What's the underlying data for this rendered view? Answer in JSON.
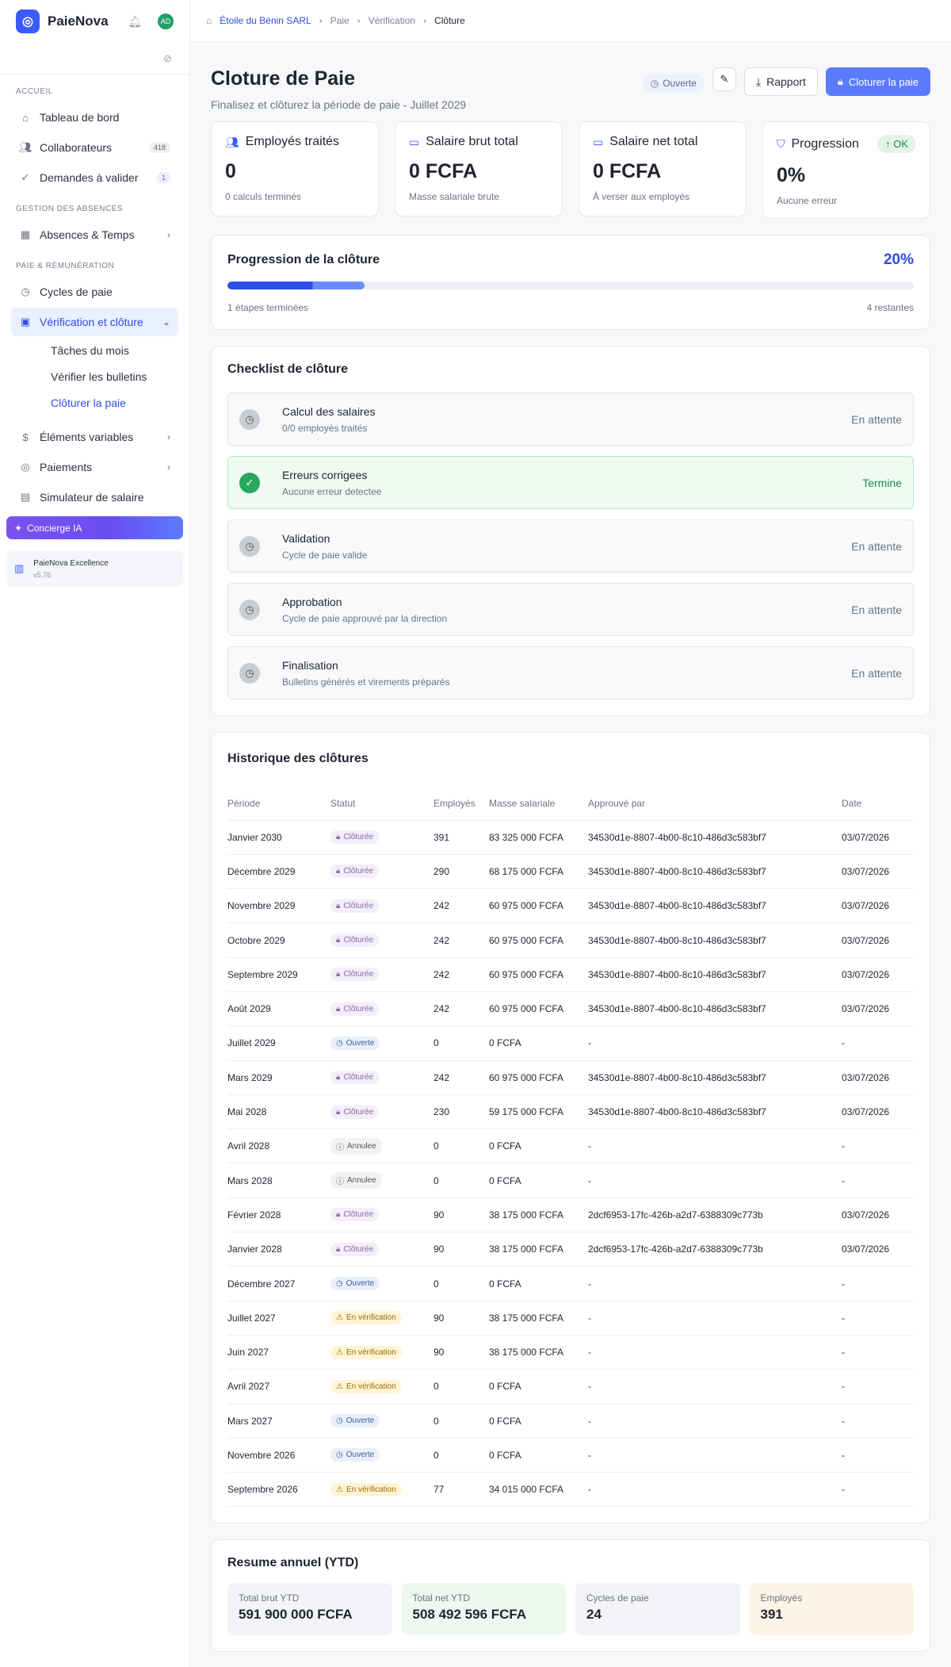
{
  "app": {
    "name": "PaieNova",
    "avatar": "AD"
  },
  "sidebar": {
    "sections": [
      "ACCUEIL",
      "GESTION DES ABSENCES",
      "PAIE & RÉMUNÉRATION"
    ],
    "home_items": [
      {
        "label": "Tableau de bord"
      },
      {
        "label": "Collaborateurs",
        "badge": "418"
      },
      {
        "label": "Demandes à valider",
        "badge": "1"
      }
    ],
    "absences": {
      "label": "Absences & Temps"
    },
    "pay_cycles": {
      "label": "Cycles de paie"
    },
    "verification": {
      "label": "Vérification et clôture"
    },
    "sub_items": [
      "Tâches du mois",
      "Vérifier les bulletins",
      "Clôturer la paie"
    ],
    "variable": {
      "label": "Éléments variables"
    },
    "payments": {
      "label": "Paiements"
    },
    "simulator": {
      "label": "Simulateur de salaire"
    },
    "concierge": {
      "label": "Concierge IA"
    },
    "footer": {
      "title": "PaieNova Excellence",
      "version": "v5.76"
    }
  },
  "breadcrumb": {
    "company": "Étoile du Bénin SARL",
    "items": [
      "Paie",
      "Vérification",
      "Clôture"
    ]
  },
  "page": {
    "title": "Cloture de Paie",
    "subtitle": "Finalisez et clôturez la période de paie - Juillet 2029",
    "status": "Ouverte",
    "report_label": "Rapport",
    "close_label": "Cloturer la paie"
  },
  "stats": [
    {
      "label": "Employés traités",
      "value": "0",
      "note": "0 calculs terminés"
    },
    {
      "label": "Salaire brut total",
      "value": "0 FCFA",
      "note": "Masse salariale brute"
    },
    {
      "label": "Salaire net total",
      "value": "0 FCFA",
      "note": "À verser aux employés"
    },
    {
      "label": "Progression",
      "value": "0%",
      "note": "Aucune erreur",
      "badge": "OK"
    }
  ],
  "progress": {
    "title": "Progression de la clôture",
    "percent": 20,
    "percent_label": "20%",
    "done": "1 étapes terminées",
    "remaining": "4 restantes"
  },
  "checklist": {
    "title": "Checklist de clôture",
    "items": [
      {
        "title": "Calcul des salaires",
        "desc": "0/0 employés traités",
        "status": "En attente",
        "done": false
      },
      {
        "title": "Erreurs corrigees",
        "desc": "Aucune erreur detectee",
        "status": "Termine",
        "done": true
      },
      {
        "title": "Validation",
        "desc": "Cycle de paie valide",
        "status": "En attente",
        "done": false
      },
      {
        "title": "Approbation",
        "desc": "Cycle de paie approuvé par la direction",
        "status": "En attente",
        "done": false
      },
      {
        "title": "Finalisation",
        "desc": "Bulletins générés et virements préparés",
        "status": "En attente",
        "done": false
      }
    ]
  },
  "history": {
    "title": "Historique des clôtures",
    "columns": [
      "Période",
      "Statut",
      "Employés",
      "Masse salariale",
      "Approuvé par",
      "Date"
    ],
    "rows": [
      {
        "period": "Janvier 2030",
        "status": "Clôturée",
        "type": "closed",
        "emp": "391",
        "mass": "83 325 000 FCFA",
        "by": "34530d1e-8807-4b00-8c10-486d3c583bf7",
        "date": "03/07/2026"
      },
      {
        "period": "Décembre 2029",
        "status": "Clôturée",
        "type": "closed",
        "emp": "290",
        "mass": "68 175 000 FCFA",
        "by": "34530d1e-8807-4b00-8c10-486d3c583bf7",
        "date": "03/07/2026"
      },
      {
        "period": "Novembre 2029",
        "status": "Clôturée",
        "type": "closed",
        "emp": "242",
        "mass": "60 975 000 FCFA",
        "by": "34530d1e-8807-4b00-8c10-486d3c583bf7",
        "date": "03/07/2026"
      },
      {
        "period": "Octobre 2029",
        "status": "Clôturée",
        "type": "closed",
        "emp": "242",
        "mass": "60 975 000 FCFA",
        "by": "34530d1e-8807-4b00-8c10-486d3c583bf7",
        "date": "03/07/2026"
      },
      {
        "period": "Septembre 2029",
        "status": "Clôturée",
        "type": "closed",
        "emp": "242",
        "mass": "60 975 000 FCFA",
        "by": "34530d1e-8807-4b00-8c10-486d3c583bf7",
        "date": "03/07/2026"
      },
      {
        "period": "Août 2029",
        "status": "Clôturée",
        "type": "closed",
        "emp": "242",
        "mass": "60 975 000 FCFA",
        "by": "34530d1e-8807-4b00-8c10-486d3c583bf7",
        "date": "03/07/2026"
      },
      {
        "period": "Juillet 2029",
        "status": "Ouverte",
        "type": "open",
        "emp": "0",
        "mass": "0 FCFA",
        "by": "-",
        "date": "-"
      },
      {
        "period": "Mars 2029",
        "status": "Clôturée",
        "type": "closed",
        "emp": "242",
        "mass": "60 975 000 FCFA",
        "by": "34530d1e-8807-4b00-8c10-486d3c583bf7",
        "date": "03/07/2026"
      },
      {
        "period": "Mai 2028",
        "status": "Clôturée",
        "type": "closed",
        "emp": "230",
        "mass": "59 175 000 FCFA",
        "by": "34530d1e-8807-4b00-8c10-486d3c583bf7",
        "date": "03/07/2026"
      },
      {
        "period": "Avril 2028",
        "status": "Annulee",
        "type": "cancel",
        "emp": "0",
        "mass": "0 FCFA",
        "by": "-",
        "date": "-"
      },
      {
        "period": "Mars 2028",
        "status": "Annulee",
        "type": "cancel",
        "emp": "0",
        "mass": "0 FCFA",
        "by": "-",
        "date": "-"
      },
      {
        "period": "Février 2028",
        "status": "Clôturée",
        "type": "closed",
        "emp": "90",
        "mass": "38 175 000 FCFA",
        "by": "2dcf6953-17fc-426b-a2d7-6388309c773b",
        "date": "03/07/2026"
      },
      {
        "period": "Janvier 2028",
        "status": "Clôturée",
        "type": "closed",
        "emp": "90",
        "mass": "38 175 000 FCFA",
        "by": "2dcf6953-17fc-426b-a2d7-6388309c773b",
        "date": "03/07/2026"
      },
      {
        "period": "Décembre 2027",
        "status": "Ouverte",
        "type": "open",
        "emp": "0",
        "mass": "0 FCFA",
        "by": "-",
        "date": "-"
      },
      {
        "period": "Juillet 2027",
        "status": "En vérification",
        "type": "verif",
        "emp": "90",
        "mass": "38 175 000 FCFA",
        "by": "-",
        "date": "-"
      },
      {
        "period": "Juin 2027",
        "status": "En vérification",
        "type": "verif",
        "emp": "90",
        "mass": "38 175 000 FCFA",
        "by": "-",
        "date": "-"
      },
      {
        "period": "Avril 2027",
        "status": "En vérification",
        "type": "verif",
        "emp": "0",
        "mass": "0 FCFA",
        "by": "-",
        "date": "-"
      },
      {
        "period": "Mars 2027",
        "status": "Ouverte",
        "type": "open",
        "emp": "0",
        "mass": "0 FCFA",
        "by": "-",
        "date": "-"
      },
      {
        "period": "Novembre 2026",
        "status": "Ouverte",
        "type": "open",
        "emp": "0",
        "mass": "0 FCFA",
        "by": "-",
        "date": "-"
      },
      {
        "period": "Septembre 2026",
        "status": "En vérification",
        "type": "verif",
        "emp": "77",
        "mass": "34 015 000 FCFA",
        "by": "-",
        "date": "-"
      }
    ]
  },
  "ytd": {
    "title": "Resume annuel (YTD)",
    "boxes": [
      {
        "label": "Total brut YTD",
        "value": "591 900 000 FCFA",
        "bg": "#f3f4f7"
      },
      {
        "label": "Total net YTD",
        "value": "508 492 596 FCFA",
        "bg": "#ecf8f0"
      },
      {
        "label": "Cycles de paie",
        "value": "24",
        "bg": "#f3f4f7"
      },
      {
        "label": "Employés",
        "value": "391",
        "bg": "#fdf3e6"
      }
    ]
  }
}
